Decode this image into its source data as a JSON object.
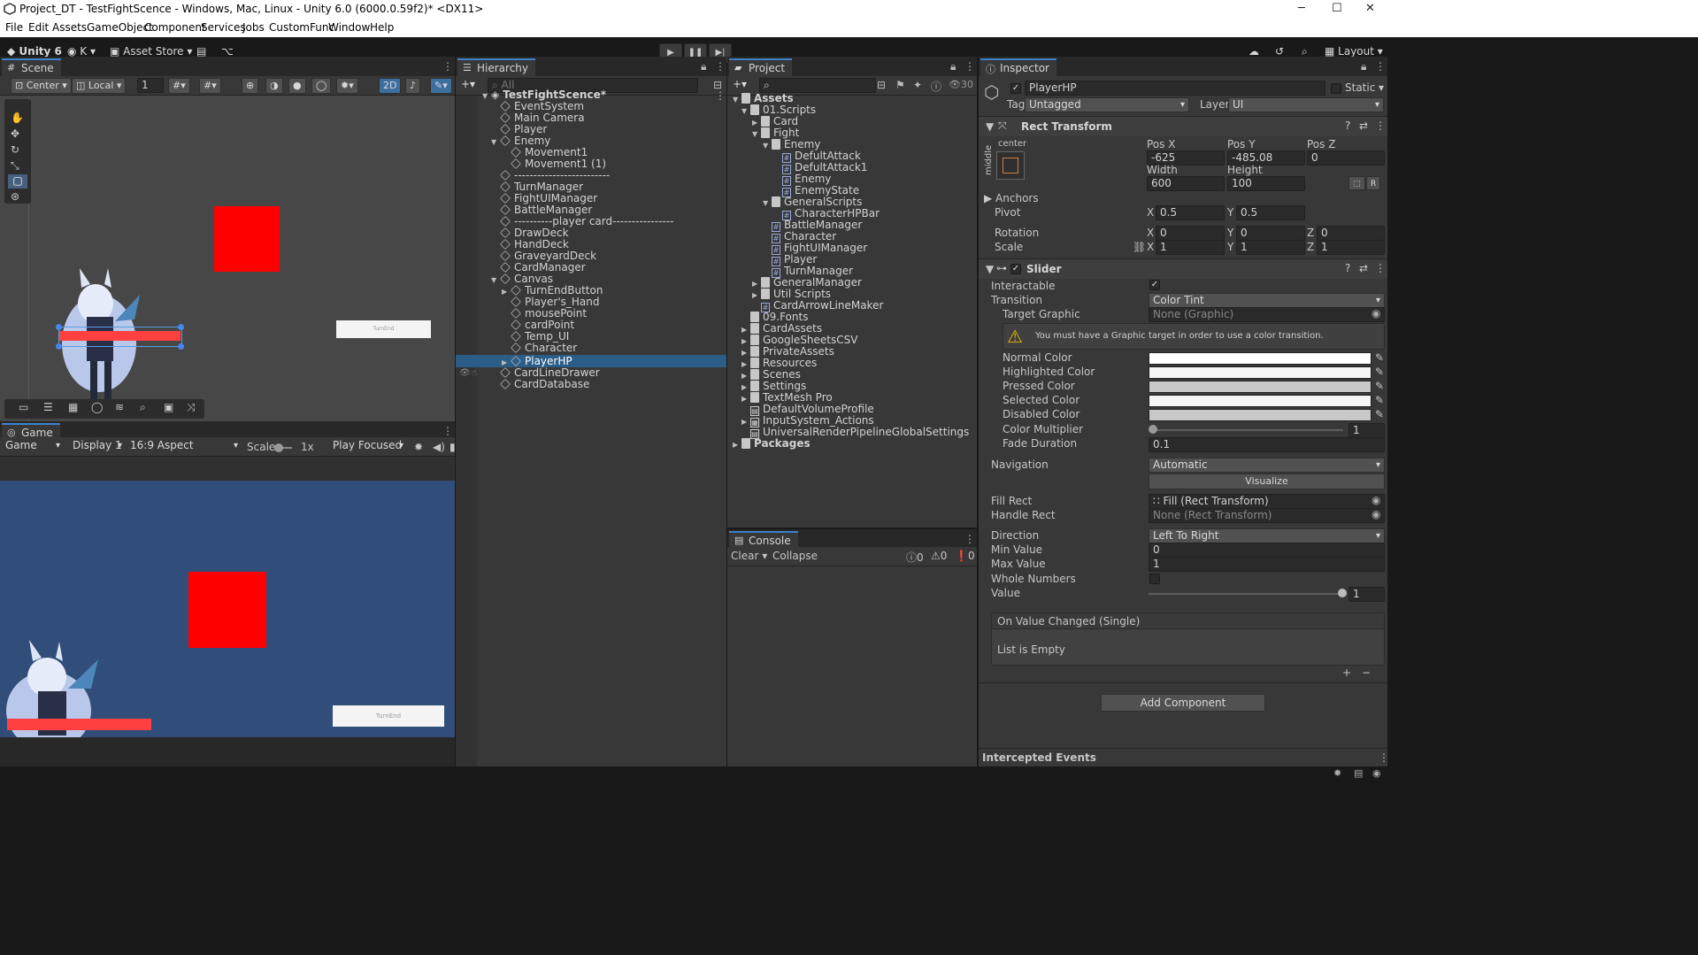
{
  "window": {
    "title": "Project_DT - TestFightScence - Windows, Mac, Linux - Unity 6.0 (6000.0.59f2)* <DX11>",
    "minimize": "─",
    "maximize": "☐",
    "close": "✕"
  },
  "menu": [
    "File",
    "Edit",
    "Assets",
    "GameObject",
    "Component",
    "Services",
    "Jobs",
    "CustomFunc",
    "Window",
    "Help"
  ],
  "toolbar": {
    "unity": "Unity 6",
    "account": "K",
    "asset_store": "Asset Store",
    "layout": "Layout"
  },
  "scene": {
    "tab": "Scene",
    "pivot": "Center",
    "space": "Local",
    "grid_snap": "1",
    "mode2d": "2D",
    "turnend_label": "TurnEnd"
  },
  "game": {
    "tab": "Game",
    "game_dropdown": "Game",
    "display": "Display 1",
    "aspect": "16:9 Aspect",
    "scale_label": "Scale",
    "scale_value": "1x",
    "play_mode": "Play Focused",
    "turnend_label": "TurnEnd"
  },
  "hierarchy": {
    "tab": "Hierarchy",
    "search_placeholder": "All",
    "scene_name": "TestFightScence*",
    "items": [
      "EventSystem",
      "Main Camera",
      "Player",
      "Enemy",
      "Movement1",
      "Movement1 (1)",
      "-------------------------",
      "TurnManager",
      "FightUIManager",
      "BattleManager",
      "----------player card----------------",
      "DrawDeck",
      "HandDeck",
      "GraveyardDeck",
      "CardManager",
      "Canvas",
      "TurnEndButton",
      "Player's_Hand",
      "mousePoint",
      "cardPoint",
      "Temp_UI",
      "Character",
      "PlayerHP",
      "CardLineDrawer",
      "CardDatabase"
    ]
  },
  "project": {
    "tab": "Project",
    "count": "30",
    "items": [
      "Assets",
      "01.Scripts",
      "Card",
      "Fight",
      "Enemy",
      "DefultAttack",
      "DefultAttack1",
      "Enemy",
      "EnemyState",
      "GeneralScripts",
      "CharacterHPBar",
      "BattleManager",
      "Character",
      "FightUIManager",
      "Player",
      "TurnManager",
      "GeneralManager",
      "Util Scripts",
      "CardArrowLineMaker",
      "09.Fonts",
      "CardAssets",
      "GoogleSheetsCSV",
      "PrivateAssets",
      "Resources",
      "Scenes",
      "Settings",
      "TextMesh Pro",
      "DefaultVolumeProfile",
      "InputSystem_Actions",
      "UniversalRenderPipelineGlobalSettings",
      "Packages"
    ]
  },
  "console": {
    "tab": "Console",
    "clear": "Clear",
    "collapse": "Collapse",
    "logs": "0",
    "warnings": "0",
    "errors": "0"
  },
  "inspector": {
    "tab": "Inspector",
    "object_name": "PlayerHP",
    "static": "Static",
    "tag_label": "Tag",
    "tag": "Untagged",
    "layer_label": "Layer",
    "layer": "UI",
    "rect": {
      "title": "Rect Transform",
      "anchor_h": "center",
      "anchor_v": "middle",
      "posx_label": "Pos X",
      "posy_label": "Pos Y",
      "posz_label": "Pos Z",
      "posx": "-625",
      "posy": "-485.08",
      "posz": "0",
      "width_label": "Width",
      "height_label": "Height",
      "width": "600",
      "height": "100",
      "anchors": "Anchors",
      "pivot": "Pivot",
      "pivot_x": "0.5",
      "pivot_y": "0.5",
      "rotation": "Rotation",
      "rot_x": "0",
      "rot_y": "0",
      "rot_z": "0",
      "scale": "Scale",
      "scale_x": "1",
      "scale_y": "1",
      "scale_z": "1",
      "x": "X",
      "y": "Y",
      "z": "Z",
      "r": "R"
    },
    "slider": {
      "title": "Slider",
      "interactable": "Interactable",
      "transition": "Transition",
      "transition_value": "Color Tint",
      "target_graphic": "Target Graphic",
      "target_graphic_value": "None (Graphic)",
      "warning": "You must have a Graphic target in order to use a color transition.",
      "normal": "Normal Color",
      "highlighted": "Highlighted Color",
      "pressed": "Pressed Color",
      "selected": "Selected Color",
      "disabled": "Disabled Color",
      "multiplier": "Color Multiplier",
      "multiplier_value": "1",
      "fade": "Fade Duration",
      "fade_value": "0.1",
      "navigation": "Navigation",
      "navigation_value": "Automatic",
      "visualize": "Visualize",
      "fill_rect": "Fill Rect",
      "fill_rect_value": "Fill (Rect Transform)",
      "handle_rect": "Handle Rect",
      "handle_rect_value": "None (Rect Transform)",
      "direction": "Direction",
      "direction_value": "Left To Right",
      "min": "Min Value",
      "min_value": "0",
      "max": "Max Value",
      "max_value": "1",
      "whole": "Whole Numbers",
      "value": "Value",
      "value_value": "1",
      "event": "On Value Changed (Single)",
      "list_empty": "List is Empty",
      "plus": "+",
      "minus": "−"
    },
    "add_component": "Add Component",
    "intercepted": "Intercepted Events"
  },
  "colors": {
    "accent": "#3d82c9",
    "selection": "#2c5d87",
    "red": "#ff0000",
    "hpbar": "#ff4040",
    "game_bg": "#314d79"
  }
}
